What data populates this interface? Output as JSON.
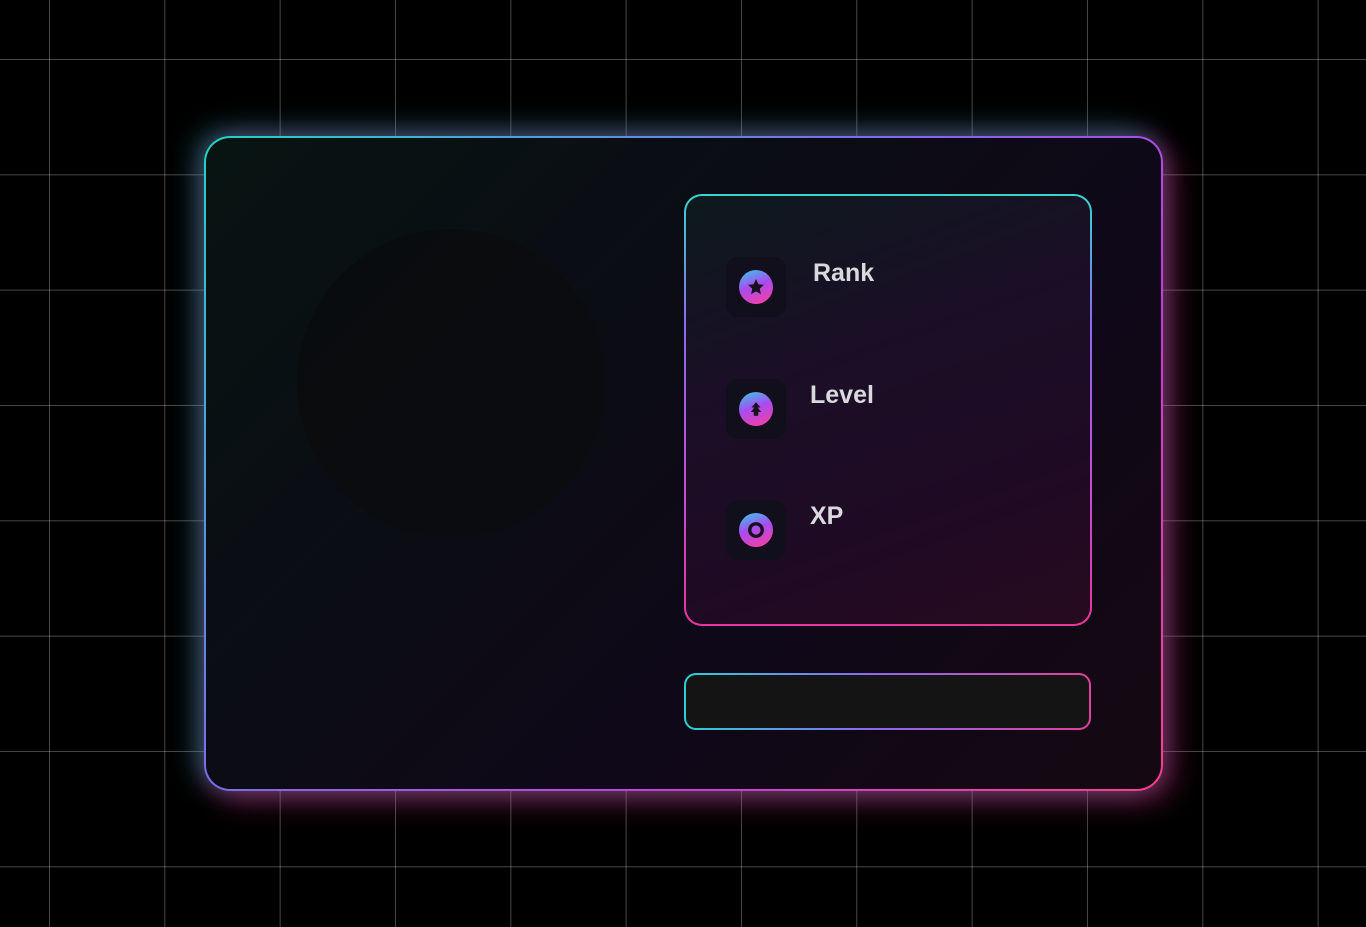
{
  "stats": {
    "items": [
      {
        "label": "Rank",
        "icon": "star-icon"
      },
      {
        "label": "Level",
        "icon": "level-up-icon"
      },
      {
        "label": "XP",
        "icon": "xp-ring-icon"
      }
    ]
  },
  "colors": {
    "accent_cyan": "#22d3c5",
    "accent_purple": "#c63ce0",
    "accent_pink": "#ff3d8a",
    "background": "#000000"
  }
}
